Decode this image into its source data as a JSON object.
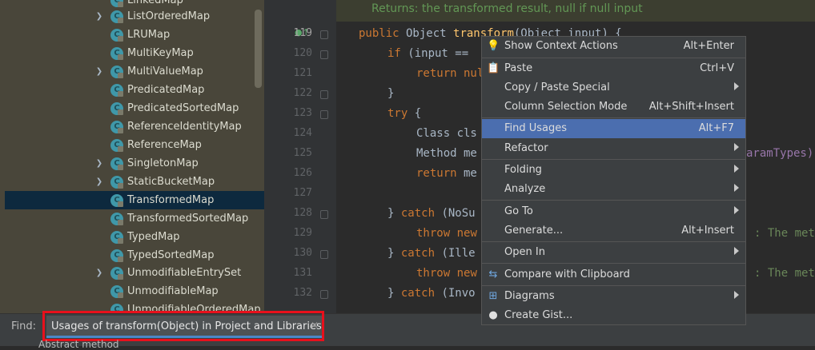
{
  "tree": {
    "items": [
      {
        "label": "LinkedMap",
        "arrow": false
      },
      {
        "label": "ListOrderedMap",
        "arrow": true
      },
      {
        "label": "LRUMap",
        "arrow": false
      },
      {
        "label": "MultiKeyMap",
        "arrow": false
      },
      {
        "label": "MultiValueMap",
        "arrow": true
      },
      {
        "label": "PredicatedMap",
        "arrow": false
      },
      {
        "label": "PredicatedSortedMap",
        "arrow": false
      },
      {
        "label": "ReferenceIdentityMap",
        "arrow": false
      },
      {
        "label": "ReferenceMap",
        "arrow": false
      },
      {
        "label": "SingletonMap",
        "arrow": true
      },
      {
        "label": "StaticBucketMap",
        "arrow": true
      },
      {
        "label": "TransformedMap",
        "arrow": false,
        "selected": true
      },
      {
        "label": "TransformedSortedMap",
        "arrow": false
      },
      {
        "label": "TypedMap",
        "arrow": false
      },
      {
        "label": "TypedSortedMap",
        "arrow": false
      },
      {
        "label": "UnmodifiableEntrySet",
        "arrow": true
      },
      {
        "label": "UnmodifiableMap",
        "arrow": false
      },
      {
        "label": "UnmodifiableOrderedMap",
        "arrow": false
      }
    ]
  },
  "editor": {
    "doc_comment": "Returns: the transformed result, null if null input",
    "line_numbers": [
      "119",
      "120",
      "121",
      "122",
      "123",
      "124",
      "125",
      "126",
      "127",
      "128",
      "129",
      "130",
      "131",
      "132"
    ],
    "lines": {
      "l119_kw": "public",
      "l119_type": " Object ",
      "l119_fn": "transform",
      "l119_rest": "(Object input) {",
      "l120_kw": "if",
      "l120_rest": " (input ==",
      "l121_kw": "return",
      "l121_rest": " nul",
      "l122": "}",
      "l123_kw": "try",
      "l123_rest": " {",
      "l124": "Class cls",
      "l125": "Method me",
      "l125_tail": "aramTypes)",
      "l126_kw": "return",
      "l126_rest": " me",
      "l128_pre": "} ",
      "l128_kw": "catch",
      "l128_rest": " (NoSu",
      "l129_kw": "throw",
      "l129_kw2": " new",
      "l129_tail": ": The met",
      "l130_pre": "} ",
      "l130_kw": "catch",
      "l130_rest": " (Ille",
      "l131_kw": "throw",
      "l131_kw2": " new",
      "l131_tail": ": The met",
      "l132_pre": "} ",
      "l132_kw": "catch",
      "l132_rest": " (Invo"
    }
  },
  "context_menu": {
    "show_context_actions": {
      "label": "Show Context Actions",
      "shortcut": "Alt+Enter"
    },
    "paste": {
      "label": "Paste",
      "shortcut": "Ctrl+V"
    },
    "copy_paste_special": {
      "label": "Copy / Paste Special"
    },
    "column_selection_mode": {
      "label": "Column Selection Mode",
      "shortcut": "Alt+Shift+Insert"
    },
    "find_usages": {
      "label": "Find Usages",
      "shortcut": "Alt+F7"
    },
    "refactor": {
      "label": "Refactor"
    },
    "folding": {
      "label": "Folding"
    },
    "analyze": {
      "label": "Analyze"
    },
    "go_to": {
      "label": "Go To"
    },
    "generate": {
      "label": "Generate...",
      "shortcut": "Alt+Insert"
    },
    "open_in": {
      "label": "Open In"
    },
    "compare_clipboard": {
      "label": "Compare with Clipboard"
    },
    "diagrams": {
      "label": "Diagrams"
    },
    "create_gist": {
      "label": "Create Gist..."
    }
  },
  "find_bar": {
    "label": "Find:",
    "tab_label": "Usages of transform(Object) in Project and Libraries",
    "below_text": "Abstract method"
  },
  "colors": {
    "selection": "#4b6eaf",
    "highlight_box": "#e8101c",
    "keyword": "#cc7832",
    "function": "#ffc66d"
  }
}
